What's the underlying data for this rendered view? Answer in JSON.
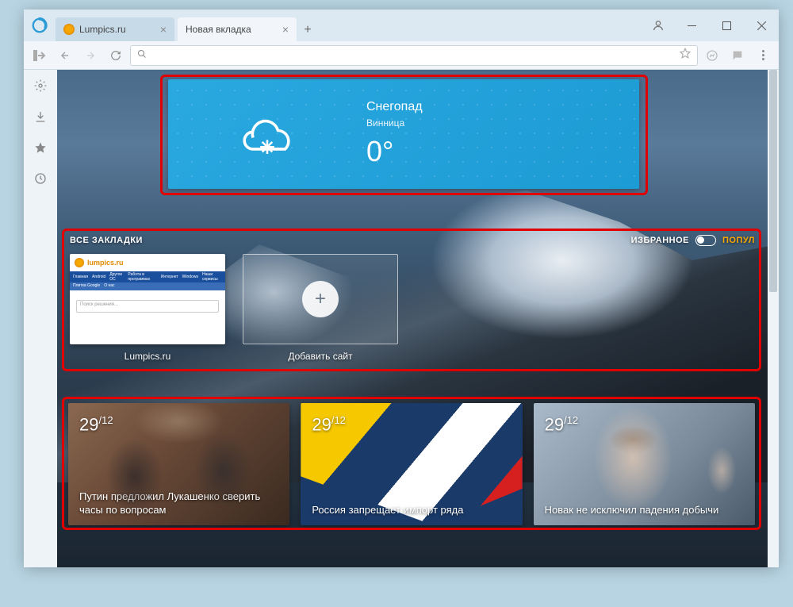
{
  "tabs": [
    {
      "label": "Lumpics.ru",
      "active": false
    },
    {
      "label": "Новая вкладка",
      "active": true
    }
  ],
  "addressbar": {
    "value": ""
  },
  "weather": {
    "condition": "Снегопад",
    "city": "Винница",
    "temperature": "0°"
  },
  "bookmarks": {
    "header_all": "ВСЕ ЗАКЛАДКИ",
    "header_fav": "ИЗБРАННОЕ",
    "header_pop": "ПОПУЛ",
    "tiles": [
      {
        "label": "Lumpics.ru"
      },
      {
        "label": "Добавить сайт"
      }
    ],
    "lumpics_preview": {
      "title": "lumpics.ru",
      "nav": [
        "Главная",
        "Android",
        "Другое ОС",
        "Работа в программах",
        "Интернет",
        "Windows",
        "Наши сервисы"
      ],
      "sub": [
        "Плитка Google",
        "О нас"
      ],
      "search_placeholder": "Поиск решения..."
    }
  },
  "news": [
    {
      "day": "29",
      "month": "12",
      "title": "Путин предложил Лукашенко сверить часы по вопросам"
    },
    {
      "day": "29",
      "month": "12",
      "title": "Россия запрещает импорт ряда"
    },
    {
      "day": "29",
      "month": "12",
      "title": "Новак не исключил падения добычи"
    }
  ]
}
